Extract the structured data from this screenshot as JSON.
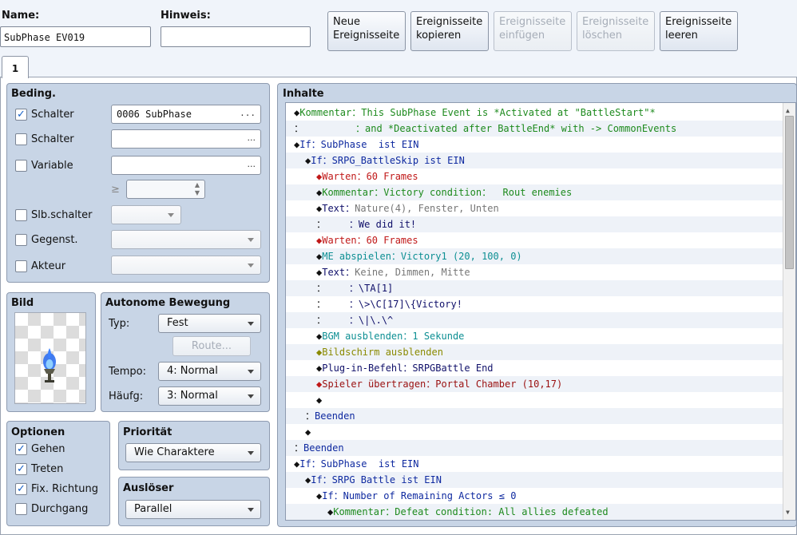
{
  "header": {
    "name_label": "Name:",
    "name_value": "SubPhase EV019",
    "hint_label": "Hinweis:",
    "hint_value": ""
  },
  "toolbar": {
    "new_page": [
      "Neue",
      "Ereignisseite"
    ],
    "copy_page": [
      "Ereignisseite",
      "kopieren"
    ],
    "paste_page": [
      "Ereignisseite",
      "einfügen"
    ],
    "delete_page": [
      "Ereignisseite",
      "löschen"
    ],
    "clear_page": [
      "Ereignisseite",
      "leeren"
    ]
  },
  "tabs": [
    {
      "label": "1"
    }
  ],
  "conditions": {
    "title": "Beding.",
    "switch1": {
      "label": "Schalter",
      "checked": true,
      "value": "0006 SubPhase"
    },
    "switch2": {
      "label": "Schalter",
      "checked": false,
      "value": ""
    },
    "variable": {
      "label": "Variable",
      "checked": false,
      "value": ""
    },
    "variable_op": "≥",
    "self_switch": {
      "label": "Slb.schalter",
      "checked": false
    },
    "item": {
      "label": "Gegenst.",
      "checked": false
    },
    "actor": {
      "label": "Akteur",
      "checked": false
    },
    "ellipsis": "..."
  },
  "image": {
    "title": "Bild"
  },
  "autonomous": {
    "title": "Autonome Bewegung",
    "type_label": "Typ:",
    "type_value": "Fest",
    "route_button": "Route...",
    "speed_label": "Tempo:",
    "speed_value": "4: Normal",
    "freq_label": "Häufg:",
    "freq_value": "3: Normal"
  },
  "options": {
    "title": "Optionen",
    "walking": {
      "label": "Gehen",
      "checked": true
    },
    "stepping": {
      "label": "Treten",
      "checked": true
    },
    "dir_fix": {
      "label": "Fix. Richtung",
      "checked": true
    },
    "through": {
      "label": "Durchgang",
      "checked": false
    }
  },
  "priority": {
    "title": "Priorität",
    "value": "Wie Charaktere"
  },
  "trigger": {
    "title": "Auslöser",
    "value": "Parallel"
  },
  "contents": {
    "title": "Inhalte",
    "rows": [
      {
        "prefix": "◆",
        "indent": 0,
        "segs": [
          [
            "Kommentar：This SubPhase Event is *Activated at \"BattleStart\"*",
            "green"
          ]
        ]
      },
      {
        "prefix": "：",
        "indent": 0,
        "segs": [
          [
            "         ：and *Deactivated after BattleEnd* with -> CommonEvents",
            "green"
          ]
        ]
      },
      {
        "prefix": "◆",
        "indent": 0,
        "segs": [
          [
            "If：SubPhase  ist EIN",
            "blue"
          ]
        ]
      },
      {
        "prefix": "◆",
        "indent": 1,
        "segs": [
          [
            "If：SRPG_BattleSkip ist EIN",
            "blue"
          ]
        ]
      },
      {
        "prefix": "◆",
        "indent": 2,
        "segs": [
          [
            "Warten：60 Frames",
            "red"
          ]
        ]
      },
      {
        "prefix": "◆",
        "indent": 2,
        "segs": [
          [
            "Kommentar：Victory condition：  Rout enemies",
            "green"
          ]
        ]
      },
      {
        "prefix": "◆",
        "indent": 2,
        "segs": [
          [
            "Text：",
            "navy"
          ],
          [
            "Nature(4), Fenster, Unten",
            "gray"
          ]
        ]
      },
      {
        "prefix": "：",
        "indent": 2,
        "segs": [
          [
            "    ：We did it!",
            "navy"
          ]
        ]
      },
      {
        "prefix": "◆",
        "indent": 2,
        "segs": [
          [
            "Warten：60 Frames",
            "red"
          ]
        ]
      },
      {
        "prefix": "◆",
        "indent": 2,
        "segs": [
          [
            "ME abspielen：Victory1 (20, 100, 0)",
            "teal"
          ]
        ]
      },
      {
        "prefix": "◆",
        "indent": 2,
        "segs": [
          [
            "Text：",
            "navy"
          ],
          [
            "Keine, Dimmen, Mitte",
            "gray"
          ]
        ]
      },
      {
        "prefix": "：",
        "indent": 2,
        "segs": [
          [
            "    ：\\TA[1]",
            "navy"
          ]
        ]
      },
      {
        "prefix": "：",
        "indent": 2,
        "segs": [
          [
            "    ：\\>\\C[17]\\{Victory!",
            "navy"
          ]
        ]
      },
      {
        "prefix": "：",
        "indent": 2,
        "segs": [
          [
            "    ：\\|\\.\\^",
            "navy"
          ]
        ]
      },
      {
        "prefix": "◆",
        "indent": 2,
        "segs": [
          [
            "BGM ausblenden：1 Sekunde",
            "teal"
          ]
        ]
      },
      {
        "prefix": "◆",
        "indent": 2,
        "segs": [
          [
            "Bildschirm ausblenden",
            "olive"
          ]
        ]
      },
      {
        "prefix": "◆",
        "indent": 2,
        "segs": [
          [
            "Plug-in-Befehl：SRPGBattle End",
            "navy"
          ]
        ]
      },
      {
        "prefix": "◆",
        "indent": 2,
        "segs": [
          [
            "Spieler übertragen：Portal Chamber (10,17)",
            "maroon"
          ]
        ]
      },
      {
        "prefix": "◆",
        "indent": 2,
        "segs": []
      },
      {
        "prefix": "：",
        "indent": 1,
        "segs": [
          [
            "Beenden",
            "blue"
          ]
        ]
      },
      {
        "prefix": "◆",
        "indent": 1,
        "segs": []
      },
      {
        "prefix": "：",
        "indent": 0,
        "segs": [
          [
            "Beenden",
            "blue"
          ]
        ]
      },
      {
        "prefix": "◆",
        "indent": 0,
        "segs": [
          [
            "If：SubPhase  ist EIN",
            "blue"
          ]
        ]
      },
      {
        "prefix": "◆",
        "indent": 1,
        "segs": [
          [
            "If：SRPG Battle ist EIN",
            "blue"
          ]
        ]
      },
      {
        "prefix": "◆",
        "indent": 2,
        "segs": [
          [
            "If：Number of Remaining Actors ≤ 0",
            "blue"
          ]
        ]
      },
      {
        "prefix": "◆",
        "indent": 3,
        "segs": [
          [
            "Kommentar：Defeat condition: All allies defeated",
            "green"
          ]
        ]
      }
    ]
  },
  "colors": {
    "green": "#1d8a1d",
    "blue": "#0f2aa0",
    "red": "#c01818",
    "gray": "#777777",
    "teal": "#0d8f93",
    "olive": "#8a8a00",
    "maroon": "#9a1010",
    "navy": "#10106a"
  }
}
